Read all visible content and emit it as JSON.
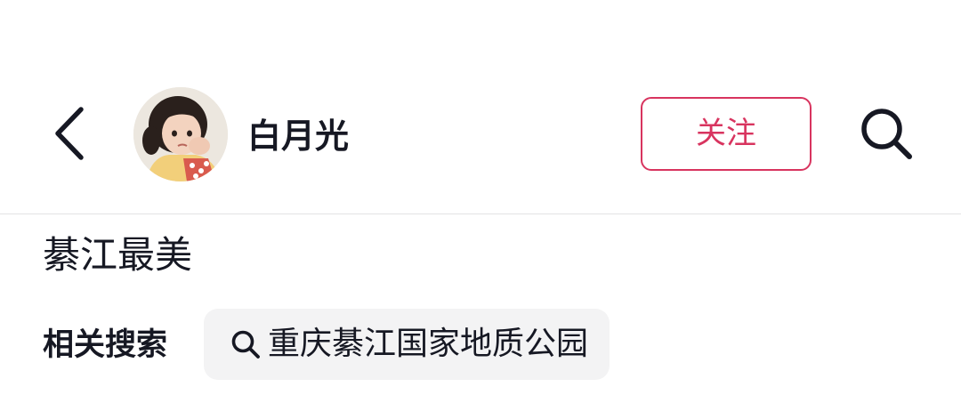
{
  "header": {
    "author_name": "白月光",
    "follow_label": "关注",
    "back_icon": "chevron-left-icon",
    "search_icon": "search-icon",
    "accent_color": "#d8345f"
  },
  "post": {
    "title": "綦江最美"
  },
  "related": {
    "label": "相关搜索",
    "items": [
      {
        "text": "重庆綦江国家地质公园",
        "icon": "search-icon"
      }
    ]
  }
}
